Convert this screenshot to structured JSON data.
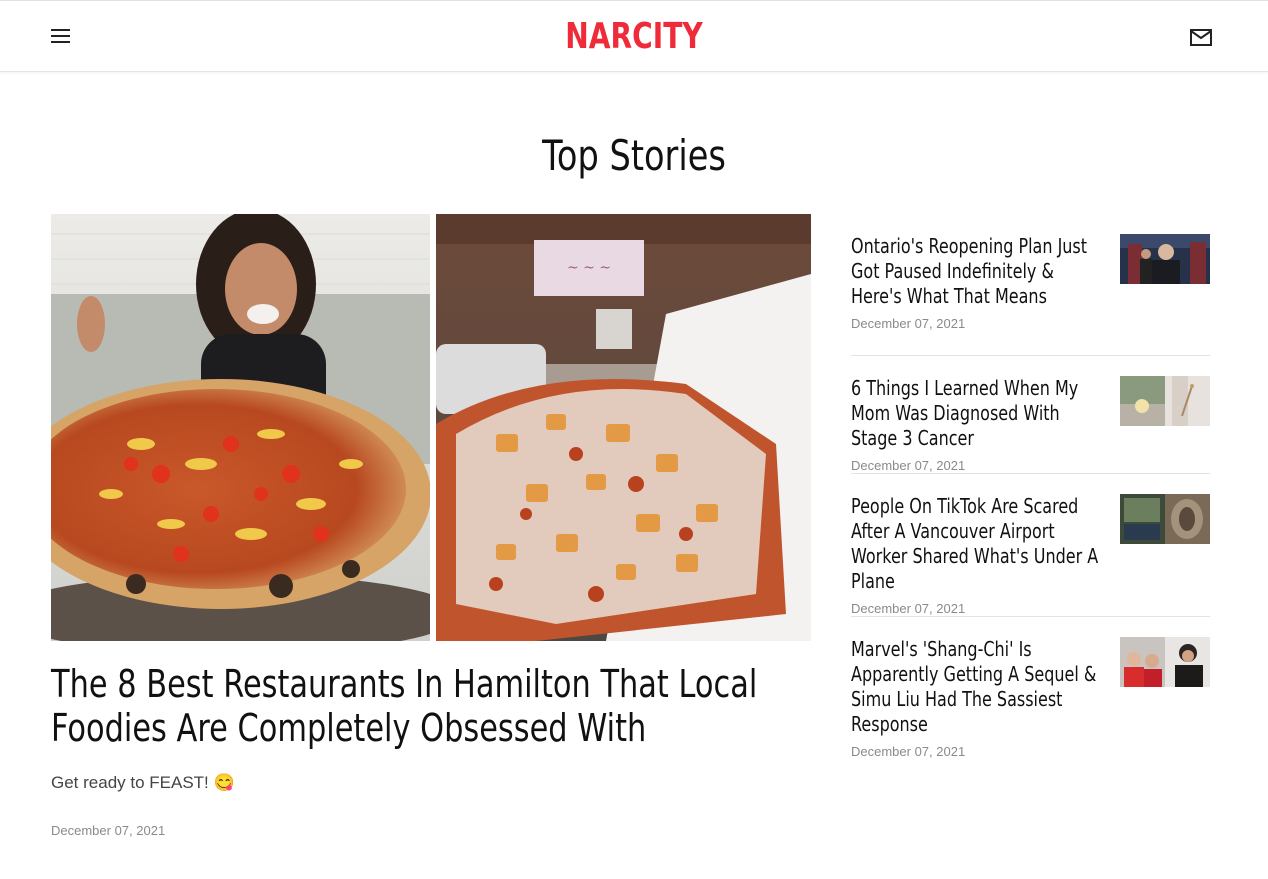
{
  "header": {
    "logo": "NARCITY",
    "menu_icon": "hamburger-menu-icon",
    "mail_icon": "mail-icon",
    "brand_color": "#ef2b39"
  },
  "section": {
    "title": "Top Stories"
  },
  "hero": {
    "title": "The 8 Best Restaurants In Hamilton That Local Foodies Are Completely Obsessed With",
    "dek": "Get ready to FEAST! 😋",
    "date": "December 07, 2021"
  },
  "stories": [
    {
      "title": "Ontario's Reopening Plan Just Got Paused Indefinitely & Here's What That Means",
      "date": "December 07, 2021"
    },
    {
      "title": "6 Things I Learned When My Mom Was Diagnosed With Stage 3 Cancer",
      "date": "December 07, 2021"
    },
    {
      "title": "People On TikTok Are Scared After A Vancouver Airport Worker Shared What's Under A Plane",
      "date": "December 07, 2021"
    },
    {
      "title": "Marvel's 'Shang-Chi' Is Apparently Getting A Sequel & Simu Liu Had The Sassiest Response",
      "date": "December 07, 2021"
    }
  ]
}
